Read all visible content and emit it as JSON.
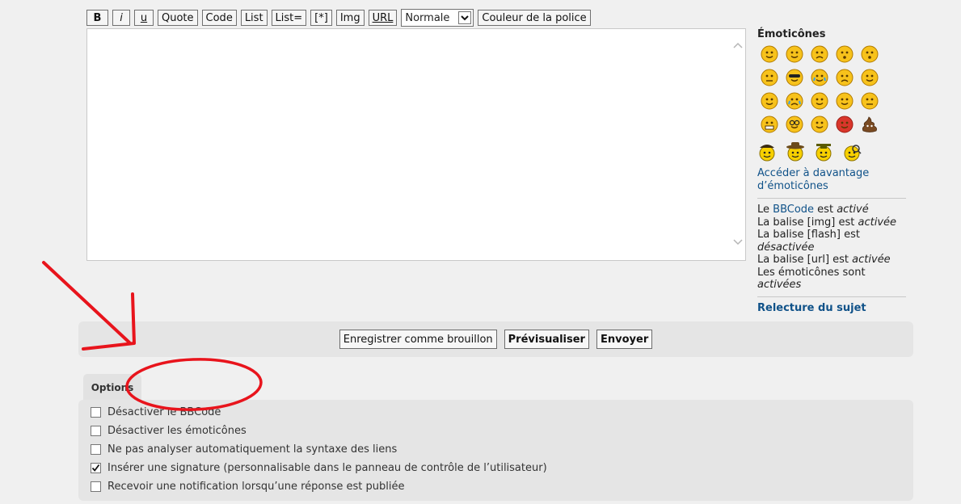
{
  "toolbar": {
    "bold": "B",
    "italic": "i",
    "underline": "u",
    "quote": "Quote",
    "code": "Code",
    "list": "List",
    "list_eq": "List=",
    "list_item": "[*]",
    "img": "Img",
    "url": "URL",
    "font_size_selected": "Normale",
    "font_color": "Couleur de la police"
  },
  "editor": {
    "value": ""
  },
  "sidebar": {
    "emoticons_title": "Émoticônes",
    "smileys": [
      "grinning-face-icon",
      "slightly-smiling-face-icon",
      "worried-face-icon",
      "hushed-face-icon",
      "flushed-face-icon",
      "confused-face-icon",
      "sunglasses-face-icon",
      "tears-of-joy-face-icon",
      "triumph-face-icon",
      "winking-tongue-face-icon",
      "blushing-face-icon",
      "crying-face-icon",
      "rolling-eyes-face-icon",
      "winking-face-icon",
      "neutral-face-icon",
      "grimacing-face-icon",
      "nerd-face-icon",
      "thinking-face-icon",
      "angry-face-icon",
      "poop-icon"
    ],
    "extra_smileys": [
      "pirate-smiley-icon",
      "cowboy-smiley-icon",
      "graduate-smiley-icon",
      "detective-smiley-icon"
    ],
    "more_link_line1": "Accéder à davantage",
    "more_link_line2": "d’émoticônes",
    "status": {
      "line1_prefix": "Le ",
      "line1_link": "BBCode",
      "line1_mid": " est ",
      "line1_state": "activé",
      "line2_text": "La balise [img] est ",
      "line2_state": "activée",
      "line3_text": "La balise [flash] est",
      "line3_state": "désactivée",
      "line4_text": "La balise [url] est ",
      "line4_state": "activée",
      "line5_text": "Les émoticônes sont",
      "line5_state": "activées"
    },
    "review_link": "Relecture du sujet"
  },
  "actions": {
    "save_draft": "Enregistrer comme brouillon",
    "preview": "Prévisualiser",
    "submit": "Envoyer"
  },
  "options": {
    "tab_label": "Options",
    "items": [
      {
        "label": "Désactiver le BBCode",
        "checked": false
      },
      {
        "label": "Désactiver les émoticônes",
        "checked": false
      },
      {
        "label": "Ne pas analyser automatiquement la syntaxe des liens",
        "checked": false
      },
      {
        "label": "Insérer une signature (personnalisable dans le panneau de contrôle de l’utilisateur)",
        "checked": true
      },
      {
        "label": "Recevoir une notification lorsqu’une réponse est publiée",
        "checked": false
      }
    ]
  },
  "colors": {
    "link": "#105289",
    "annotation": "#e8141c",
    "smiley_yellow": "#f7c21b"
  }
}
